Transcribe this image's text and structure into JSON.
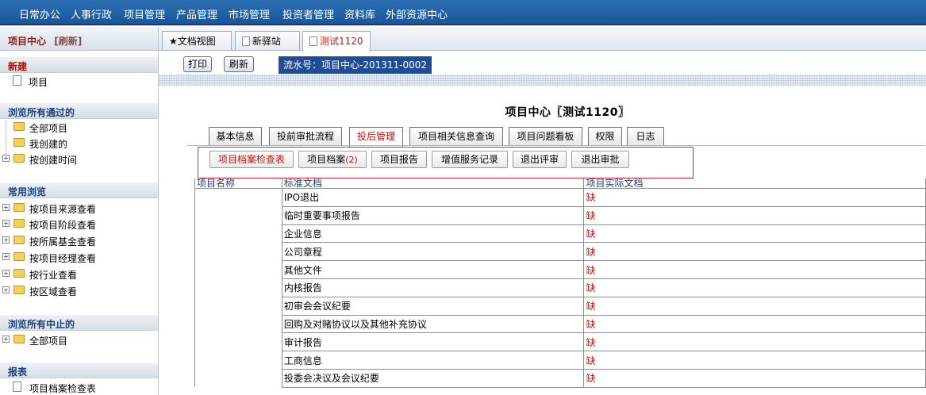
{
  "topnav": {
    "items": [
      "日常办公",
      "人事行政",
      "项目管理",
      "产品管理",
      "市场管理",
      "投资者管理",
      "资料库",
      "外部资源中心"
    ]
  },
  "sidebar": {
    "header_title": "项目中心",
    "header_refresh": "[刷新]",
    "section_new": "新建",
    "new_items": [
      "项目"
    ],
    "section_browse_approved": "浏览所有通过的",
    "approved_items": [
      "全部项目",
      "我创建的",
      "按创建时间"
    ],
    "section_common": "常用浏览",
    "common_items": [
      "按项目来源查看",
      "按项目阶段查看",
      "按所属基金查看",
      "按项目经理查看",
      "按行业查看",
      "按区域查看"
    ],
    "section_browse_stopped": "浏览所有中止的",
    "stopped_items": [
      "全部项目"
    ],
    "section_report": "报表",
    "report_items": [
      "项目档案检查表"
    ]
  },
  "doc_tabs": [
    {
      "label": "★文档视图"
    },
    {
      "label": "新驿站"
    },
    {
      "label": "测试1120"
    }
  ],
  "toolbar": {
    "print_label": "打印",
    "refresh_label": "刷新",
    "serial": "流水号：项目中心-201311-0002"
  },
  "project_title": "项目中心〖测试1120〗",
  "main_tabs": [
    "基本信息",
    "投前审批流程",
    "投后管理",
    "项目相关信息查询",
    "项目问题看板",
    "权限",
    "日志"
  ],
  "sub_tabs": [
    {
      "label": "项目档案检查表",
      "count": ""
    },
    {
      "label": "项目档案",
      "count": "(2)"
    },
    {
      "label": "项目报告",
      "count": ""
    },
    {
      "label": "增值服务记录",
      "count": ""
    },
    {
      "label": "退出评审",
      "count": ""
    },
    {
      "label": "退出审批",
      "count": ""
    }
  ],
  "table": {
    "headers": [
      "项目名称",
      "标准文档",
      "项目实际文档"
    ],
    "rows": [
      {
        "doc": "IPO退出",
        "actual": "缺"
      },
      {
        "doc": "临时重要事项报告",
        "actual": "缺"
      },
      {
        "doc": "企业信息",
        "actual": "缺"
      },
      {
        "doc": "公司章程",
        "actual": "缺"
      },
      {
        "doc": "其他文件",
        "actual": "缺"
      },
      {
        "doc": "内核报告",
        "actual": "缺"
      },
      {
        "doc": "初审会会议纪要",
        "actual": "缺"
      },
      {
        "doc": "回购及对赌协议以及其他补充协议",
        "actual": "缺"
      },
      {
        "doc": "审计报告",
        "actual": "缺"
      },
      {
        "doc": "工商信息",
        "actual": "缺"
      },
      {
        "doc": "投委会决议及会议纪要",
        "actual": "缺"
      }
    ]
  },
  "colors": {
    "nav_blue": "#1a5699",
    "serial_bg": "#1f4e96",
    "missing_red": "#d4130b",
    "highlight_red": "#e3262b",
    "section_red": "#b0120a"
  }
}
